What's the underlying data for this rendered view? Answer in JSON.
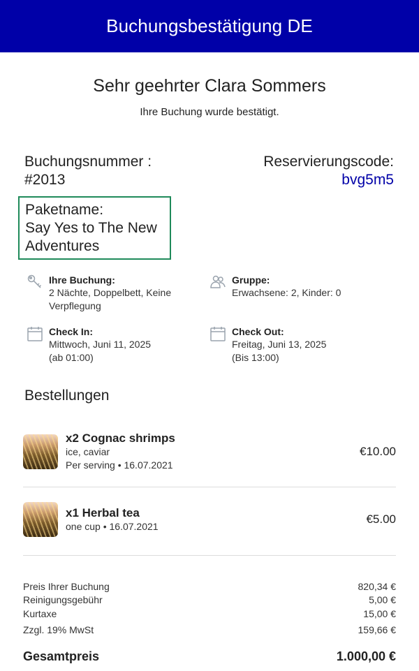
{
  "header": {
    "title": "Buchungsbestätigung DE"
  },
  "greeting": {
    "salutation": "Sehr geehrter Clara Sommers",
    "message": "Ihre Buchung wurde bestätigt."
  },
  "booking": {
    "number_label": "Buchungsnummer :",
    "number_value": "#2013",
    "code_label": "Reservierungscode:",
    "code_value": "bvg5m5"
  },
  "package": {
    "label": "Paketname:",
    "name_line1": "Say Yes to The New",
    "name_line2": "Adventures"
  },
  "details": {
    "booking": {
      "label": "Ihre Buchung:",
      "line1": "2 Nächte, Doppelbett, Keine",
      "line2": "Verpflegung",
      "icon": "key-icon"
    },
    "group": {
      "label": "Gruppe:",
      "line1": "Erwachsene: 2, Kinder: 0",
      "icon": "group-icon"
    },
    "checkin": {
      "label": "Check In:",
      "line1": "Mittwoch, Juni 11, 2025",
      "line2": "(ab 01:00)",
      "icon": "calendar-icon"
    },
    "checkout": {
      "label": "Check Out:",
      "line1": "Freitag, Juni 13, 2025",
      "line2": "(Bis 13:00)",
      "icon": "calendar-icon"
    }
  },
  "orders": {
    "title": "Bestellungen",
    "items": [
      {
        "name": "x2 Cognac shrimps",
        "desc1": "ice, caviar",
        "desc2": "Per serving • 16.07.2021",
        "price": "€10.00"
      },
      {
        "name": "x1 Herbal tea",
        "desc1": "one cup • 16.07.2021",
        "price": "€5.00"
      }
    ]
  },
  "summary": {
    "rows": [
      {
        "label": "Preis Ihrer Buchung",
        "value": "820,34 €"
      },
      {
        "label": "Reinigungsgebühr",
        "value": "5,00 €"
      },
      {
        "label": "Kurtaxe",
        "value": "15,00 €"
      },
      {
        "label": "Zzgl. 19% MwSt",
        "value": "159,66 €"
      }
    ],
    "total_label": "Gesamtpreis",
    "total_value": "1.000,00 €"
  },
  "colors": {
    "header_bg": "#0000a8",
    "code_color": "#0000a8",
    "package_border": "#1f8a5a"
  }
}
